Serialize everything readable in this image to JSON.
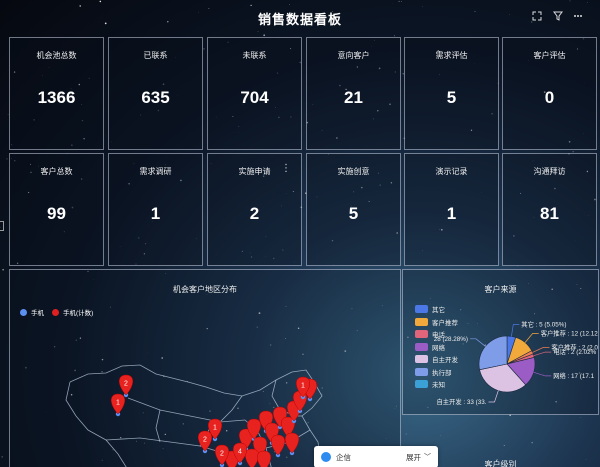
{
  "header": {
    "title": "销售数据看板",
    "icons": [
      "fullscreen-icon",
      "filter-icon",
      "more-icon"
    ]
  },
  "kpi_row1": [
    {
      "label": "机会池总数",
      "value": "1366"
    },
    {
      "label": "已联系",
      "value": "635"
    },
    {
      "label": "未联系",
      "value": "704"
    },
    {
      "label": "意向客户",
      "value": "21"
    },
    {
      "label": "需求评估",
      "value": "5"
    },
    {
      "label": "客户评估",
      "value": "0"
    }
  ],
  "kpi_row2": [
    {
      "label": "客户总数",
      "value": "99"
    },
    {
      "label": "需求调研",
      "value": "1"
    },
    {
      "label": "实施申请",
      "value": "2"
    },
    {
      "label": "实施创意",
      "value": "5"
    },
    {
      "label": "演示记录",
      "value": "1"
    },
    {
      "label": "沟通拜访",
      "value": "81"
    }
  ],
  "map_panel": {
    "title": "机会客户地区分布",
    "legend": [
      {
        "name": "手机",
        "color": "#5b8ff0"
      },
      {
        "name": "手机(计数)",
        "color": "#e02020"
      }
    ],
    "pin_labels": [
      "2",
      "1",
      "2",
      "1",
      "1",
      "2",
      "4"
    ]
  },
  "chart_data": {
    "type": "pie",
    "title": "客户来源",
    "slices": [
      {
        "name": "其它",
        "value": 5,
        "percent": "5.05%",
        "color": "#4b78e6",
        "label": "其它 : 5 (5.05%)"
      },
      {
        "name": "客户推荐",
        "value": 12,
        "percent": "12.12%",
        "color": "#f2a93b",
        "label": "客户推荐 : 12 (12.12%)"
      },
      {
        "name": "客户推荐2",
        "value": 2,
        "percent": "2.02%",
        "color": "#ef7d55",
        "label": "客户推荐 : 2 (2.02"
      },
      {
        "name": "电话",
        "value": 2,
        "percent": "2.02%",
        "color": "#e0657b",
        "label": "电话 : 2 (2.02%"
      },
      {
        "name": "网络",
        "value": 17,
        "percent": "17.1",
        "color": "#9c5cc6",
        "label": "网络 : 17 (17.1"
      },
      {
        "name": "自主开发",
        "value": 33,
        "percent": "33.",
        "color": "#dcc3e4",
        "label": "自主开发 : 33 (33."
      },
      {
        "name": "其它来源",
        "value": 28,
        "percent": "28.28%",
        "color": "#7f9ce8",
        "label": "28 (28.28%)"
      },
      {
        "name": "未知",
        "value": 0,
        "color": "#3aa0d6",
        "label": ""
      }
    ],
    "legend": [
      {
        "name": "其它",
        "color": "#4b78e6"
      },
      {
        "name": "客户推荐",
        "color": "#f2a93b"
      },
      {
        "name": "电话",
        "color": "#e0657b"
      },
      {
        "name": "网络",
        "color": "#9c5cc6"
      },
      {
        "name": "自主开发",
        "color": "#dcc3e4"
      },
      {
        "name": "执行部",
        "color": "#7f9ce8"
      },
      {
        "name": "未知",
        "color": "#3aa0d6"
      }
    ]
  },
  "chat_widget": {
    "label": "企信",
    "expand": "展开"
  },
  "bottom_panel": {
    "title": "客户级别"
  }
}
